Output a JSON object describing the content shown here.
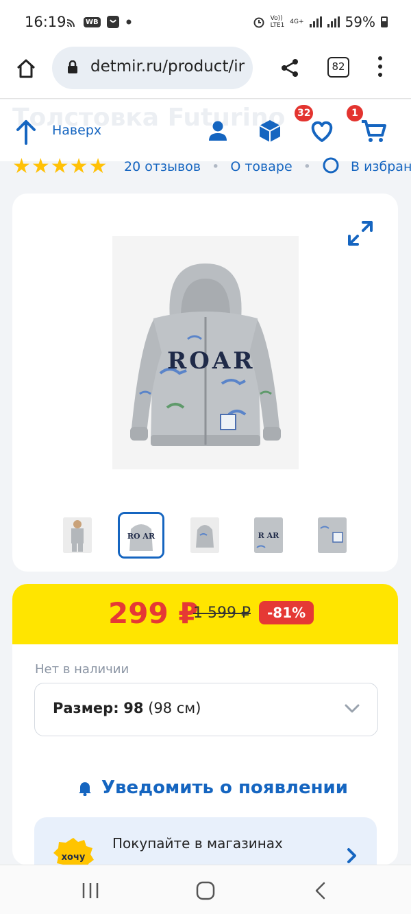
{
  "status_bar": {
    "time": "16:19",
    "icons": [
      "cast-icon",
      "wb-app-icon",
      "shopping-bag-icon",
      "dot-icon"
    ],
    "wb_label": "WB",
    "network": "LTE1",
    "network2": "4G+",
    "volte": "Vo))",
    "battery": "59%"
  },
  "browser": {
    "url": "detmir.ru/product/ir",
    "tab_count": "82"
  },
  "header": {
    "ghost_title": "Толстовка Futurino",
    "up_label": "Наверх",
    "favorites_badge": "32",
    "cart_badge": "1"
  },
  "ratings": {
    "stars": "★★★★★",
    "reviews": "20 отзывов",
    "about": "О товаре",
    "favorite": "В избранное"
  },
  "product": {
    "print_text": "ROAR",
    "thumbnails": [
      "thumb-child",
      "thumb-front",
      "thumb-back",
      "thumb-detail-print",
      "thumb-detail-patch"
    ],
    "selected_thumbnail": 1
  },
  "price": {
    "current": "299 ₽",
    "old": "1 599 ₽",
    "discount": "-81%"
  },
  "availability": {
    "status": "Нет в наличии",
    "size_label": "Размер:",
    "size_value": "98",
    "size_hint": "(98 см)"
  },
  "notify": {
    "label": "Уведомить о появлении"
  },
  "promo": {
    "sticker": "хочу",
    "text": "Покупайте в магазинах"
  },
  "colors": {
    "accent": "#1565c0",
    "price_red": "#e53935",
    "price_bar": "#ffe500",
    "badge_red": "#e3342f"
  }
}
